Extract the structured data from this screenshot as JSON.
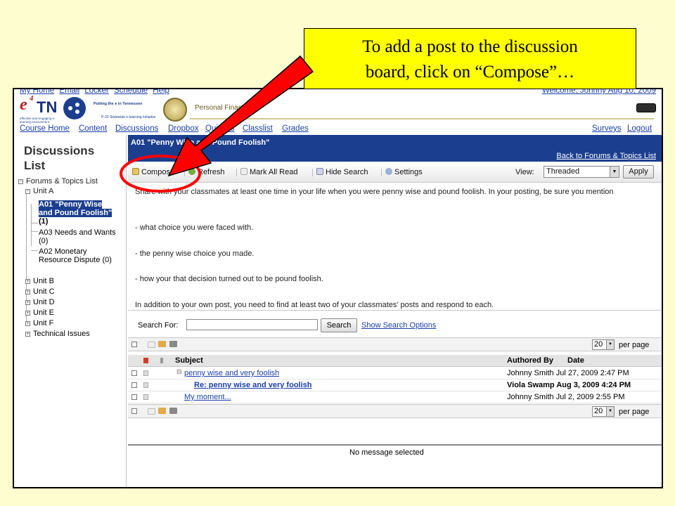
{
  "callout": {
    "text_line1": "To add a post to the discussion",
    "text_line2": "board, click on “Compose”…"
  },
  "top_links": [
    "My Home",
    "Email",
    "Locker",
    "Schedule",
    "Help"
  ],
  "welcome": "Welcome, Johnny  Aug 10, 2009",
  "banner": {
    "logo_text_e": "e",
    "logo_text_sup": "4",
    "logo_text_tn": "TN",
    "logo_tagline": "effective and engaging e-learning environment",
    "putting": "Putting the e in Tennessee",
    "p20": "P-20 Statewide e-learning Initiative",
    "course_title": "Personal Finance"
  },
  "nav": {
    "course_home": "Course Home",
    "content": "Content",
    "discussions": "Discussions",
    "dropbox": "Dropbox",
    "quizzes": "Quizzes",
    "classlist": "Classlist",
    "grades": "Grades",
    "surveys": "Surveys",
    "logout": "Logout"
  },
  "sidebar": {
    "title": "Discussions List",
    "root": "Forums & Topics List",
    "unit_a": "Unit A",
    "topic_selected": "A01 \"Penny Wise and Pound Foolish\"",
    "topic_selected_count": "(1)",
    "topic_2": "A03 Needs and Wants (0)",
    "topic_3": "A02 Monetary Resource Dispute (0)",
    "units": [
      "Unit B",
      "Unit C",
      "Unit D",
      "Unit E",
      "Unit F",
      "Technical Issues"
    ]
  },
  "main": {
    "topic_title": "A01 \"Penny Wise and Pound Foolish\"",
    "back_link": "Back to Forums & Topics List"
  },
  "toolbar": {
    "compose": "Compose",
    "refresh": "Refresh",
    "mark_all_read": "Mark All Read",
    "hide_search": "Hide Search",
    "settings": "Settings",
    "view_label": "View:",
    "view_value": "Threaded",
    "apply": "Apply"
  },
  "description": {
    "p1": "Share with your classmates at least one time in your life when you were penny wise and pound foolish. In your posting, be sure you mention",
    "p2": "- what choice you were faced with.",
    "p3": "- the penny wise choice you made.",
    "p4": "- how your that decision turned out to be pound foolish.",
    "p5": "In addition to your own post, you need to find at least two of your classmates’ posts and respond to each."
  },
  "search": {
    "label": "Search For:",
    "value": "",
    "button": "Search",
    "options_link": "Show Search Options"
  },
  "pager": {
    "per_page_value": "20",
    "per_page_label": "per page"
  },
  "table": {
    "col_subject": "Subject",
    "col_authored": "Authored By",
    "col_date": "Date",
    "rows": [
      {
        "subject": "penny wise and very foolish",
        "author": "Johnny Smith",
        "date": "Jul 27, 2009 2:47 PM",
        "unread": false
      },
      {
        "subject": "Re: penny wise and very foolish",
        "author": "Viola Swamp",
        "date": "Aug 3, 2009 4:24 PM",
        "unread": true
      },
      {
        "subject": "My moment...",
        "author": "Johnny Smith",
        "date": "Jul 2, 2009 2:55 PM",
        "unread": false
      }
    ]
  },
  "preview": {
    "text": "No message selected"
  },
  "colors": {
    "accent_blue": "#1b3e8f",
    "link_blue": "#1a3ea8",
    "callout_yellow": "#ffff00",
    "arrow_red": "#ff0000",
    "slide_bg": "#fefdd0"
  }
}
